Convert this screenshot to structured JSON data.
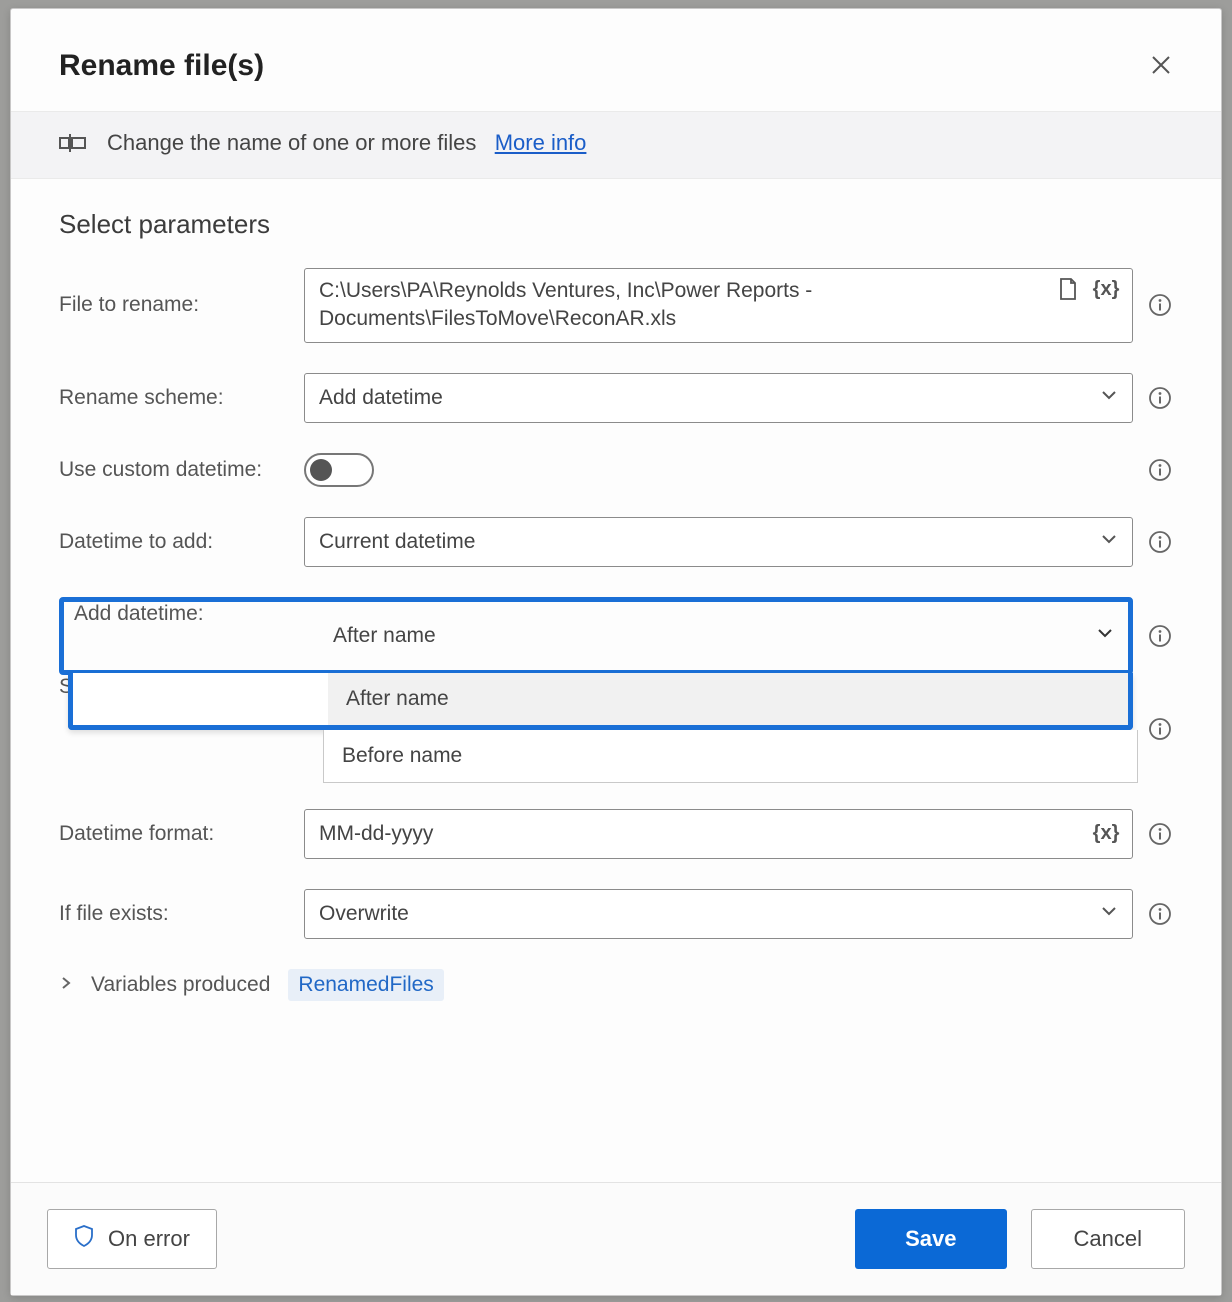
{
  "dialog": {
    "title": "Rename file(s)",
    "description": "Change the name of one or more files",
    "more_info": "More info",
    "section_title": "Select parameters"
  },
  "fields": {
    "file_to_rename": {
      "label": "File to rename:",
      "value": "C:\\Users\\PA\\Reynolds Ventures, Inc\\Power Reports - Documents\\FilesToMove\\ReconAR.xls"
    },
    "rename_scheme": {
      "label": "Rename scheme:",
      "value": "Add datetime"
    },
    "use_custom_datetime": {
      "label": "Use custom datetime:",
      "value": false
    },
    "datetime_to_add": {
      "label": "Datetime to add:",
      "value": "Current datetime"
    },
    "add_datetime": {
      "label": "Add datetime:",
      "value": "After name",
      "options": [
        "After name",
        "Before name"
      ]
    },
    "separator": {
      "label": "Separator:",
      "value": ""
    },
    "datetime_format": {
      "label": "Datetime format:",
      "value": "MM-dd-yyyy"
    },
    "if_file_exists": {
      "label": "If file exists:",
      "value": "Overwrite"
    }
  },
  "variables": {
    "label": "Variables produced",
    "chip": "RenamedFiles"
  },
  "footer": {
    "on_error": "On error",
    "save": "Save",
    "cancel": "Cancel"
  }
}
